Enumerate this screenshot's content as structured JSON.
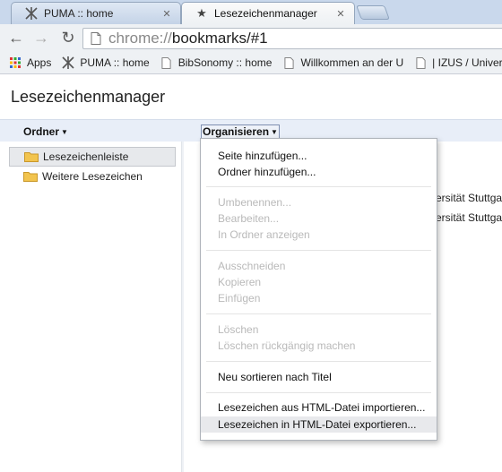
{
  "tabs": [
    {
      "title": "PUMA :: home",
      "close": "✕"
    },
    {
      "title": "Lesezeichenmanager",
      "close": "✕"
    }
  ],
  "address": {
    "scheme": "chrome://",
    "rest": "bookmarks/#1"
  },
  "bookmarks_bar": {
    "items": [
      {
        "label": "Apps",
        "icon": "apps-grid-icon"
      },
      {
        "label": "PUMA :: home",
        "icon": "puma-icon"
      },
      {
        "label": "BibSonomy :: home",
        "icon": "page-icon"
      },
      {
        "label": "Willkommen an der U",
        "icon": "page-icon"
      },
      {
        "label": "| IZUS / Univer",
        "icon": "page-icon"
      }
    ]
  },
  "page": {
    "title": "Lesezeichenmanager",
    "ordner_label": "Ordner",
    "organisieren_label": "Organisieren"
  },
  "tree": [
    {
      "label": "Lesezeichenleiste",
      "selected": true
    },
    {
      "label": "Weitere Lesezeichen",
      "selected": false
    }
  ],
  "list_fragments": [
    "versität Stuttga",
    "versität Stuttga"
  ],
  "menu": {
    "groups": [
      [
        {
          "label": "Seite hinzufügen...",
          "enabled": true
        },
        {
          "label": "Ordner hinzufügen...",
          "enabled": true
        }
      ],
      [
        {
          "label": "Umbenennen...",
          "enabled": false
        },
        {
          "label": "Bearbeiten...",
          "enabled": false
        },
        {
          "label": "In Ordner anzeigen",
          "enabled": false
        }
      ],
      [
        {
          "label": "Ausschneiden",
          "enabled": false
        },
        {
          "label": "Kopieren",
          "enabled": false
        },
        {
          "label": "Einfügen",
          "enabled": false
        }
      ],
      [
        {
          "label": "Löschen",
          "enabled": false
        },
        {
          "label": "Löschen rückgängig machen",
          "enabled": false
        }
      ],
      [
        {
          "label": "Neu sortieren nach Titel",
          "enabled": true
        }
      ],
      [
        {
          "label": "Lesezeichen aus HTML-Datei importieren...",
          "enabled": true
        },
        {
          "label": "Lesezeichen in HTML-Datei exportieren...",
          "enabled": true,
          "hover": true
        }
      ]
    ]
  },
  "colors": {
    "folder": "#f2c44e",
    "hover": "#e8e9ec",
    "disabled_text": "#b9b9b9"
  }
}
